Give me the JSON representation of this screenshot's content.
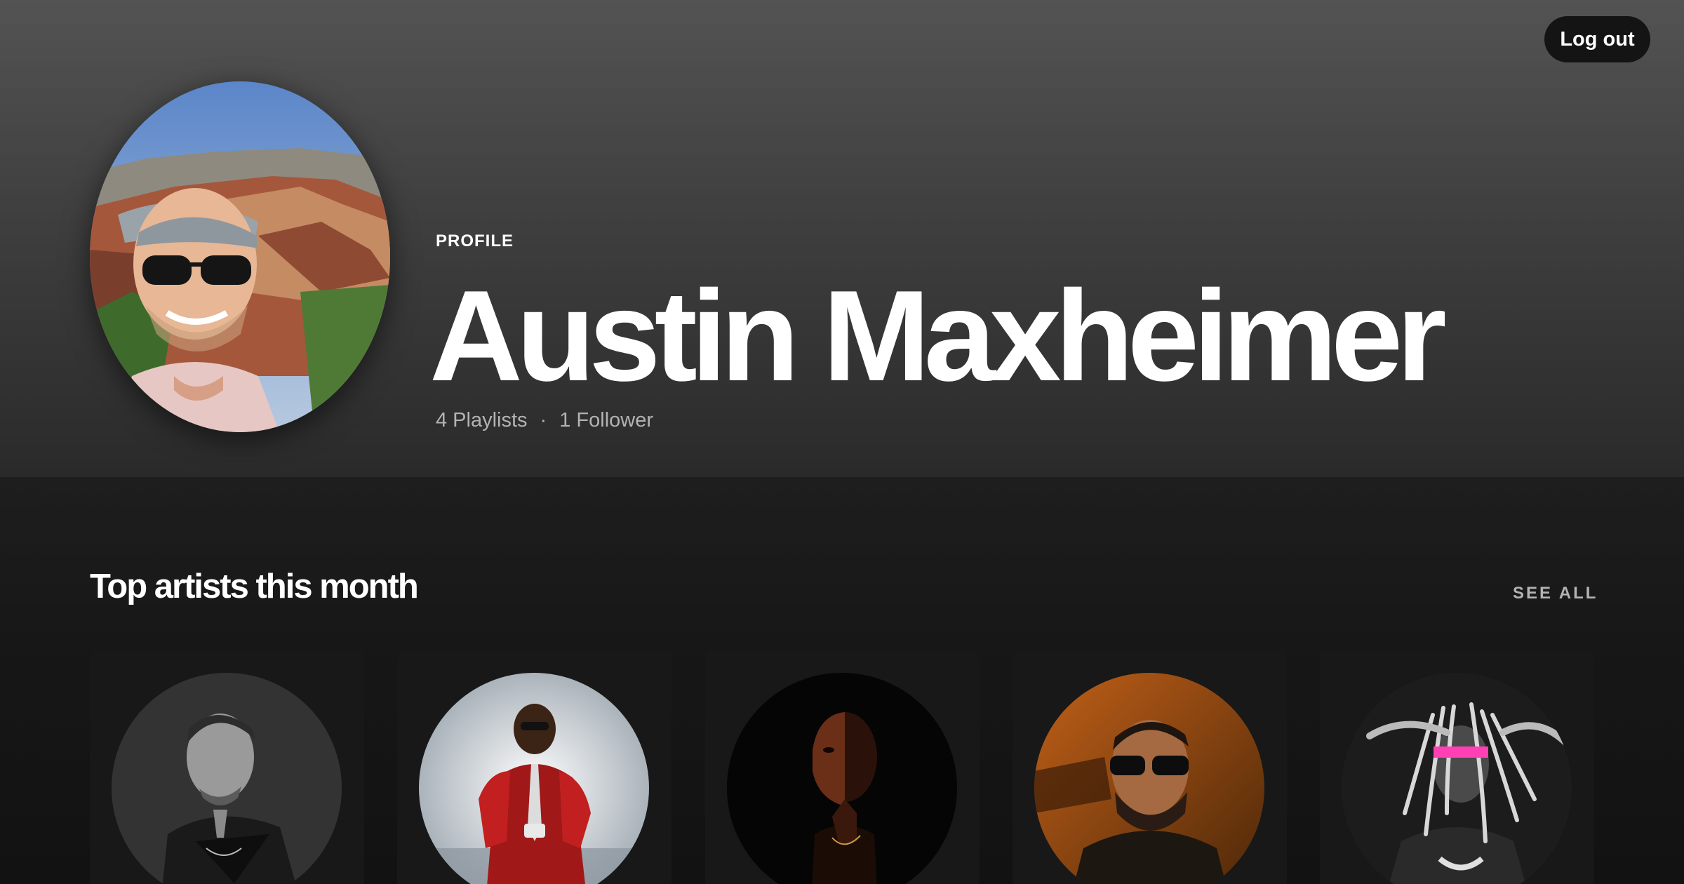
{
  "header": {
    "logout_label": "Log out",
    "profile_label": "PROFILE",
    "name": "Austin Maxheimer",
    "playlists": "4 Playlists",
    "separator": "·",
    "followers": "1 Follower"
  },
  "top_artists": {
    "title": "Top artists this month",
    "see_all_label": "SEE ALL",
    "artists": [
      {
        "image": "artist-photo-1"
      },
      {
        "image": "artist-photo-2"
      },
      {
        "image": "artist-photo-3"
      },
      {
        "image": "artist-photo-4"
      },
      {
        "image": "artist-photo-5"
      }
    ]
  },
  "colors": {
    "header_top": "#535353",
    "header_bottom": "#2a2a2a",
    "background": "#121212",
    "card": "#181818",
    "muted_text": "#b3b3b3",
    "accent_pink": "#ff3fb4"
  }
}
